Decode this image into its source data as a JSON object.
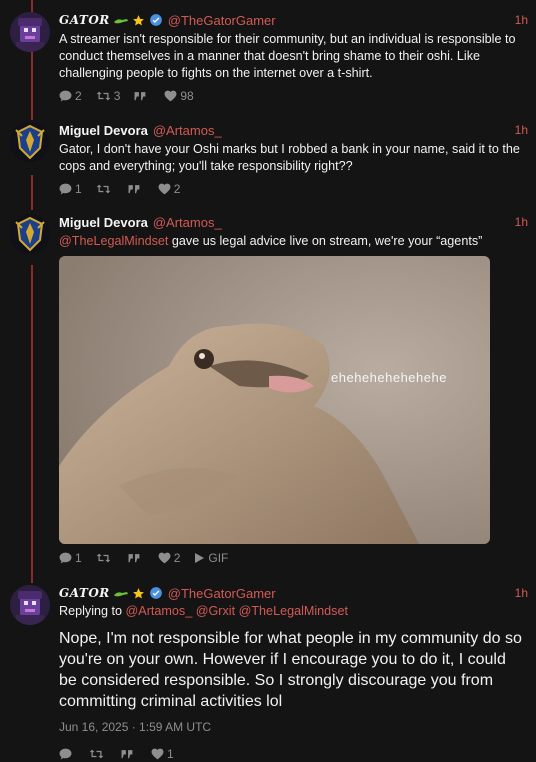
{
  "tweets": [
    {
      "fullname": "GATOR",
      "handle": "@TheGatorGamer",
      "time": "1h",
      "text": "A streamer isn't responsible for their community, but an individual is responsible to conduct themselves in a manner that doesn't bring shame to their oshi. Like challenging people to fights on the internet over a t-shirt.",
      "replies": "2",
      "retweets": "3",
      "quotes": "",
      "likes": "98"
    },
    {
      "fullname": "Miguel Devora",
      "handle": "@Artamos_",
      "time": "1h",
      "text": "Gator, I don't have your Oshi marks but I robbed a bank in your name, said it to the cops and everything; you'll take responsibility right??",
      "replies": "1",
      "retweets": "",
      "quotes": "",
      "likes": "2"
    },
    {
      "fullname": "Miguel Devora",
      "handle": "@Artamos_",
      "time": "1h",
      "mention": "@TheLegalMindset",
      "text": " gave us legal advice live on stream, we're your “agents”",
      "media_caption": "ehehehehehehehe",
      "replies": "1",
      "retweets": "",
      "quotes": "",
      "likes": "2",
      "gif_label": "GIF"
    },
    {
      "fullname": "GATOR",
      "handle": "@TheGatorGamer",
      "time": "1h",
      "replying_prefix": "Replying to",
      "replying_to": [
        "@Artamos_",
        "@Grxit",
        "@TheLegalMindset"
      ],
      "text": "Nope, I'm not responsible for what people in my community do so you're on your own. However if I encourage you to do it, I could be considered responsible. So I strongly discourage you from committing criminal activities lol",
      "date": "Jun 16, 2025 · 1:59 AM UTC",
      "replies": "",
      "retweets": "",
      "quotes": "",
      "likes": "1"
    }
  ],
  "colors": {
    "background": "#141414",
    "accent": "#d25a55",
    "thread_line": "#8b2a2a",
    "muted": "#8e8e8e",
    "verified": "#4a90e2"
  }
}
